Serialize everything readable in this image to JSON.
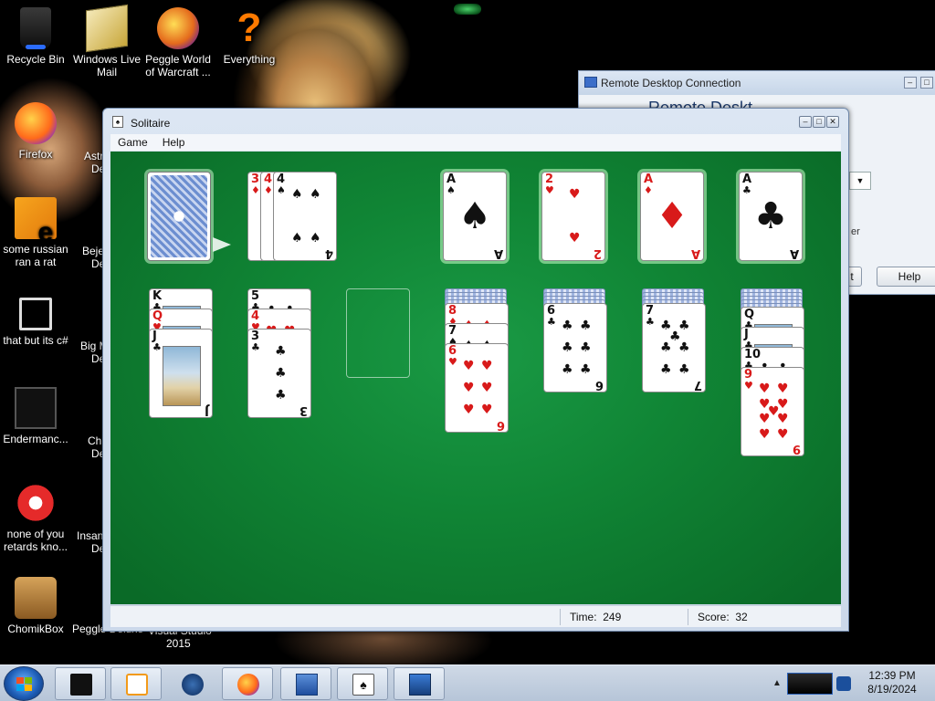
{
  "desktop": {
    "icons": [
      {
        "label": "Recycle Bin",
        "icon": "recycle-bin-icon"
      },
      {
        "label": "Windows Live Mail",
        "icon": "mail-icon"
      },
      {
        "label": "Peggle World of Warcraft ...",
        "icon": "peggle-icon"
      },
      {
        "label": "Everything",
        "icon": "search-icon"
      },
      {
        "label": "Firefox",
        "icon": "firefox-icon"
      },
      {
        "label": "some russian ran a rat",
        "icon": "file-icon"
      },
      {
        "label": "that but its c#",
        "icon": "shortcut-icon"
      },
      {
        "label": "Endermanc...",
        "icon": "app-icon"
      },
      {
        "label": "none of you retards kno...",
        "icon": "app-icon"
      },
      {
        "label": "ChomikBox",
        "icon": "chomikbox-icon"
      },
      {
        "label": "Peggle Deluxe",
        "icon": "peggle-icon"
      }
    ],
    "partial_labels": [
      "Astr",
      "De",
      "Beje",
      "De",
      "Big M",
      "De",
      "Ch",
      "De",
      "Insan",
      "De",
      "Visual Studio",
      "2015"
    ]
  },
  "remote_desktop": {
    "title": "Remote Desktop Connection",
    "heading_fragment": "Remote Deskt",
    "text_fragment": "er",
    "buttons": [
      "t",
      "Help"
    ]
  },
  "solitaire": {
    "title": "Solitaire",
    "menu": [
      "Game",
      "Help"
    ],
    "status": {
      "time_label": "Time:",
      "time_value": "249",
      "score_label": "Score:",
      "score_value": "32"
    },
    "waste": [
      {
        "rank": "3",
        "suit": "♦",
        "color": "red"
      },
      {
        "rank": "4",
        "suit": "♦",
        "color": "red"
      },
      {
        "rank": "4",
        "suit": "♠",
        "color": "black"
      }
    ],
    "foundations": [
      {
        "rank": "A",
        "suit": "♠",
        "color": "black"
      },
      {
        "rank": "2",
        "suit": "♥",
        "color": "red"
      },
      {
        "rank": "A",
        "suit": "♦",
        "color": "red"
      },
      {
        "rank": "A",
        "suit": "♣",
        "color": "black"
      }
    ],
    "tableau": [
      {
        "hidden": 0,
        "cards": [
          {
            "rank": "K",
            "suit": "♣",
            "color": "black"
          },
          {
            "rank": "Q",
            "suit": "♥",
            "color": "red"
          },
          {
            "rank": "J",
            "suit": "♣",
            "color": "black"
          }
        ]
      },
      {
        "hidden": 0,
        "cards": [
          {
            "rank": "5",
            "suit": "♣",
            "color": "black"
          },
          {
            "rank": "4",
            "suit": "♥",
            "color": "red"
          },
          {
            "rank": "3",
            "suit": "♣",
            "color": "black"
          }
        ]
      },
      {
        "hidden": 0,
        "cards": []
      },
      {
        "hidden": 4,
        "cards": [
          {
            "rank": "8",
            "suit": "♦",
            "color": "red"
          },
          {
            "rank": "7",
            "suit": "♠",
            "color": "black"
          },
          {
            "rank": "6",
            "suit": "♥",
            "color": "red"
          }
        ]
      },
      {
        "hidden": 4,
        "cards": [
          {
            "rank": "6",
            "suit": "♣",
            "color": "black"
          }
        ]
      },
      {
        "hidden": 4,
        "cards": [
          {
            "rank": "7",
            "suit": "♣",
            "color": "black"
          }
        ]
      },
      {
        "hidden": 5,
        "cards": [
          {
            "rank": "Q",
            "suit": "♣",
            "color": "black"
          },
          {
            "rank": "J",
            "suit": "♣",
            "color": "black"
          },
          {
            "rank": "10",
            "suit": "♣",
            "color": "black"
          },
          {
            "rank": "9",
            "suit": "♥",
            "color": "red"
          }
        ]
      }
    ]
  },
  "taskbar": {
    "items": [
      "terminal-icon",
      "media-player-icon",
      "globe-icon",
      "firefox-icon",
      "remote-desktop-icon",
      "solitaire-icon",
      "network-icon"
    ],
    "clock": {
      "time": "12:39 PM",
      "date": "8/19/2024"
    }
  },
  "colors": {
    "felt": "#108535",
    "red_suit": "#d81a1a",
    "taskbar": "#c3cfdf"
  }
}
